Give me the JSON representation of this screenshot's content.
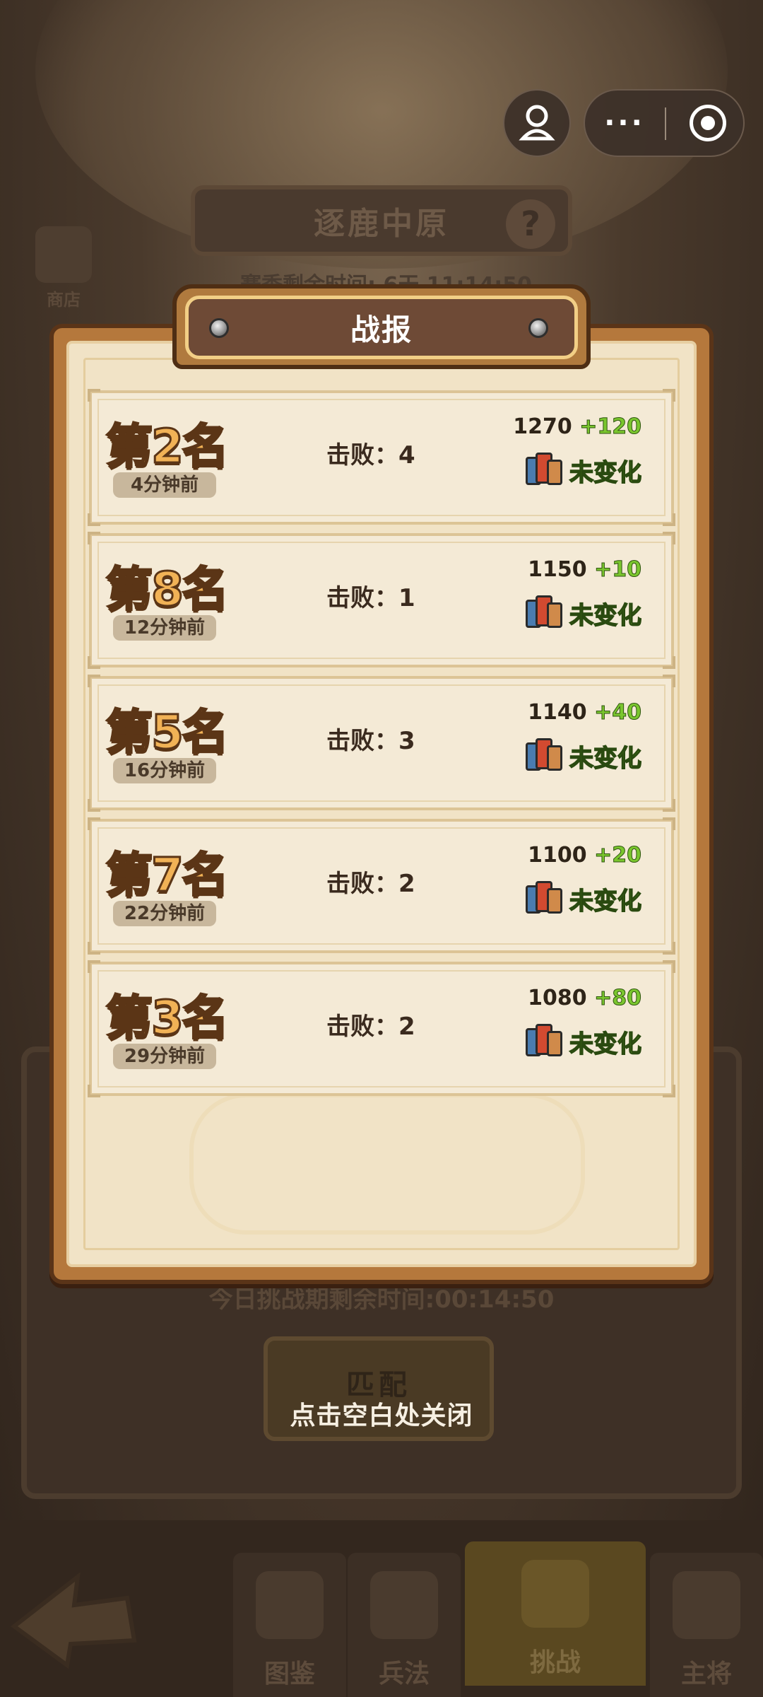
{
  "background": {
    "mode_title": "逐鹿中原",
    "help_icon": "question-icon",
    "season_text": "赛季剩余时间: 6天 11:14:50",
    "shop_label": "商店",
    "challenge_remaining": "今日挑战期剩余时间:00:14:50",
    "match_button": "匹配"
  },
  "close_hint": "点击空白处关闭",
  "popup": {
    "title": "战报",
    "reports": [
      {
        "rank": "第2名",
        "time": "4分钟前",
        "defeats_label": "击败：",
        "defeats": "4",
        "score": "1270",
        "delta": "+120",
        "status": "未变化"
      },
      {
        "rank": "第8名",
        "time": "12分钟前",
        "defeats_label": "击败：",
        "defeats": "1",
        "score": "1150",
        "delta": "+10",
        "status": "未变化"
      },
      {
        "rank": "第5名",
        "time": "16分钟前",
        "defeats_label": "击败：",
        "defeats": "3",
        "score": "1140",
        "delta": "+40",
        "status": "未变化"
      },
      {
        "rank": "第7名",
        "time": "22分钟前",
        "defeats_label": "击败：",
        "defeats": "2",
        "score": "1100",
        "delta": "+20",
        "status": "未变化"
      },
      {
        "rank": "第3名",
        "time": "29分钟前",
        "defeats_label": "击败：",
        "defeats": "2",
        "score": "1080",
        "delta": "+80",
        "status": "未变化"
      }
    ]
  },
  "capsule": {
    "more_label": "···",
    "left_icon": "avatar-icon",
    "right_icon": "target-icon"
  },
  "bottom_nav": {
    "back_icon": "back-arrow-icon",
    "tabs": [
      {
        "label": "图鉴",
        "icon": "tent-icon"
      },
      {
        "label": "兵法",
        "icon": "scroll-icon"
      },
      {
        "label": "挑战",
        "icon": "crossed-swords-icon"
      },
      {
        "label": "主将",
        "icon": "helmet-icon"
      }
    ]
  },
  "colors": {
    "rank_fill": "#f1b256",
    "rank_outline": "#5b3516",
    "positive": "#7ac62e",
    "paper": "#f1e3c6"
  }
}
